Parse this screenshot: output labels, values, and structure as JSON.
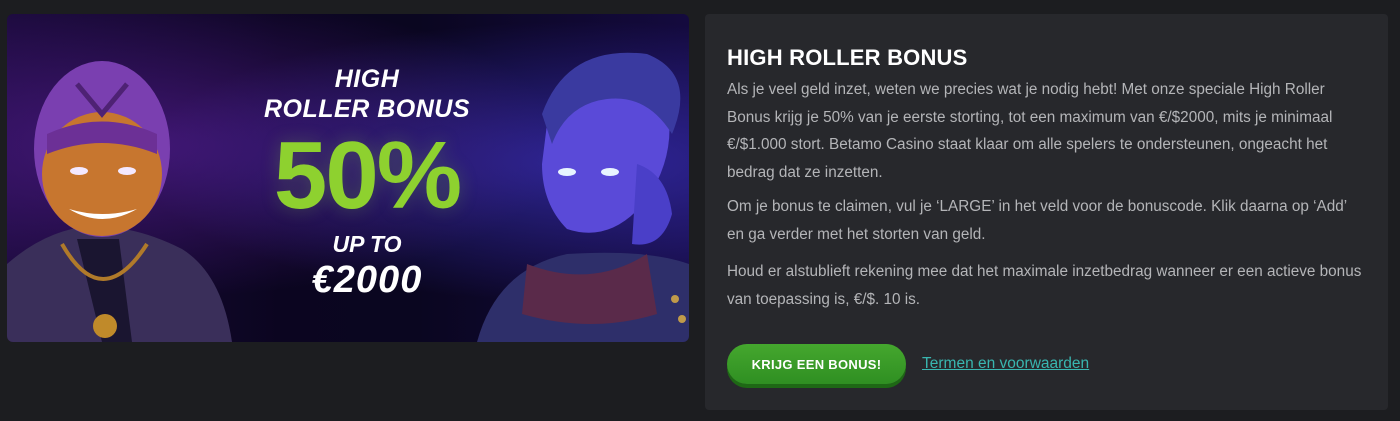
{
  "banner": {
    "line1": "HIGH",
    "line2": "ROLLER BONUS",
    "percent": "50%",
    "line3": "UP TO",
    "amount": "€2000"
  },
  "panel": {
    "title": "HIGH ROLLER BONUS",
    "paragraphs": [
      "Als je veel geld inzet, weten we precies wat je nodig hebt! Met onze speciale High Roller Bonus krijg je 50% van je eerste storting, tot een maximum van €/$2000, mits je minimaal €/$1.000 stort. Betamo Casino staat klaar om alle spelers te ondersteunen, ongeacht het bedrag dat ze inzetten.",
      "Om je bonus te claimen, vul je ‘LARGE’ in het veld voor de bonuscode. Klik daarna op ‘Add’ en ga verder met het storten van geld.",
      "Houd er alstublieft rekening mee dat het maximale inzetbedrag wanneer er een actieve bonus van toepassing is, €/$. 10 is."
    ],
    "cta_label": "KRIJG EEN BONUS!",
    "terms_label": "Termen en voorwaarden"
  },
  "colors": {
    "page_bg": "#1c1d20",
    "panel_bg": "#27282c",
    "accent_green": "#8ed12f",
    "button_green": "#3c9d29",
    "link_teal": "#39b6b0"
  }
}
